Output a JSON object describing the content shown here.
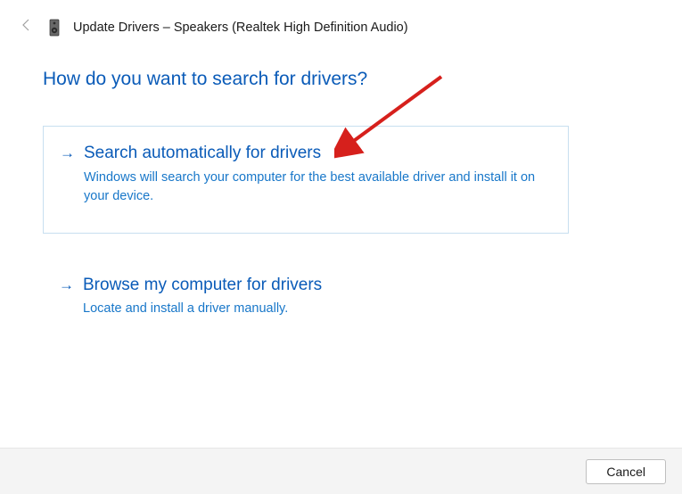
{
  "window": {
    "title": "Update Drivers – Speakers (Realtek High Definition Audio)"
  },
  "heading": "How do you want to search for drivers?",
  "options": [
    {
      "title": "Search automatically for drivers",
      "description": "Windows will search your computer for the best available driver and install it on your device."
    },
    {
      "title": "Browse my computer for drivers",
      "description": "Locate and install a driver manually."
    }
  ],
  "footer": {
    "cancel_label": "Cancel"
  }
}
